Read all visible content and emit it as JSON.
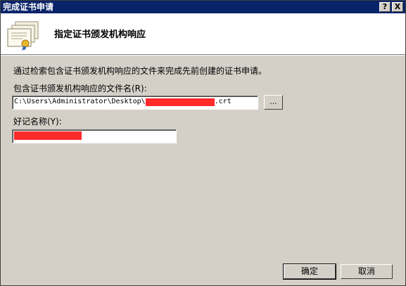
{
  "window": {
    "title": "完成证书申请",
    "help_glyph": "?",
    "close_glyph": "X"
  },
  "header": {
    "title": "指定证书颁发机构响应"
  },
  "content": {
    "description": "通过检索包含证书颁发机构响应的文件来完成先前创建的证书申请。",
    "file_label": "包含证书颁发机构响应的文件名(R):",
    "file_value_prefix": "C:\\Users\\Administrator\\Desktop\\",
    "file_value_suffix": ".crt",
    "browse_label": "...",
    "name_label": "好记名称(Y):"
  },
  "buttons": {
    "ok": "确定",
    "cancel": "取消"
  },
  "colors": {
    "titlebar": "#0a246a",
    "redaction": "#ff2a2a",
    "dialog_bg": "#d4d0c8"
  }
}
